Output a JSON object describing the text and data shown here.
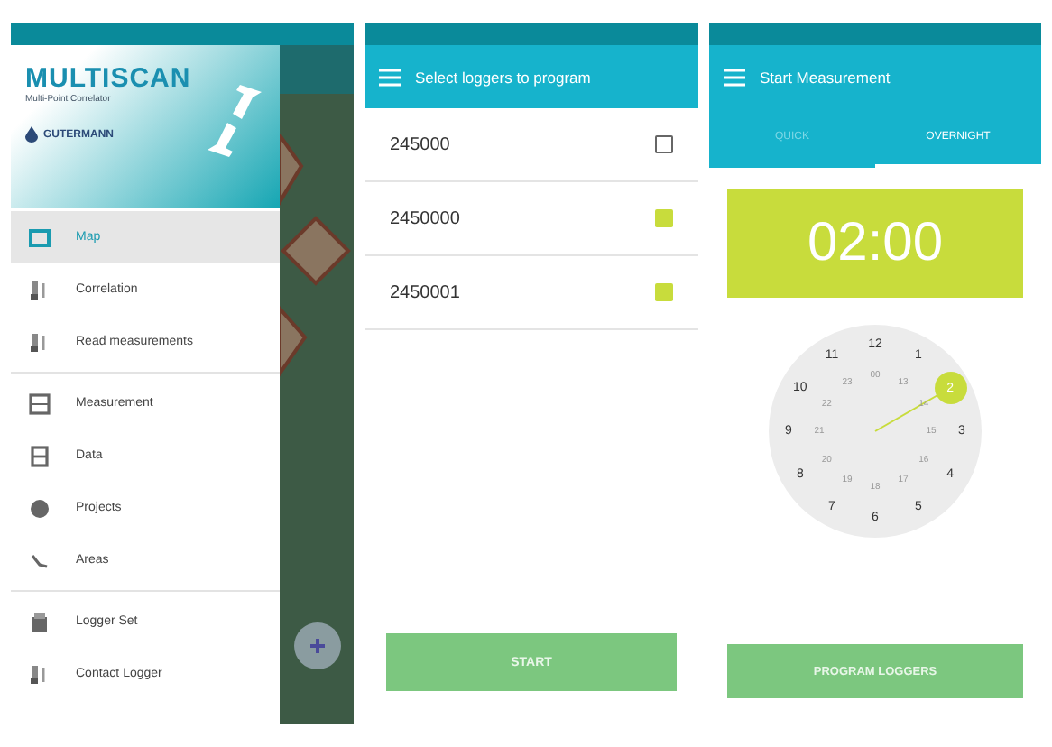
{
  "drawer": {
    "logo": {
      "brand": "MULTISCAN",
      "subtitle": "Multi-Point Correlator",
      "maker": "GUTERMANN"
    },
    "groups": [
      [
        {
          "label": "Map",
          "selected": true
        },
        {
          "label": "Correlation",
          "selected": false
        },
        {
          "label": "Read measurements",
          "selected": false
        }
      ],
      [
        {
          "label": "Measurement",
          "selected": false
        },
        {
          "label": "Data",
          "selected": false
        },
        {
          "label": "Projects",
          "selected": false
        },
        {
          "label": "Areas",
          "selected": false
        }
      ],
      [
        {
          "label": "Logger Set",
          "selected": false
        },
        {
          "label": "Contact Logger",
          "selected": false
        }
      ]
    ]
  },
  "logger_screen": {
    "title": "Select loggers to program",
    "loggers": [
      {
        "id": "245000",
        "checked": false
      },
      {
        "id": "2450000",
        "checked": true
      },
      {
        "id": "2450001",
        "checked": true
      }
    ],
    "button": "START"
  },
  "measure_screen": {
    "title": "Start Measurement",
    "tabs": [
      {
        "label": "QUICK",
        "selected": false
      },
      {
        "label": "OVERNIGHT",
        "selected": true
      }
    ],
    "time": "02:00",
    "clock": {
      "outer": [
        {
          "label": "12",
          "selected": false
        },
        {
          "label": "1",
          "selected": false
        },
        {
          "label": "2",
          "selected": true
        },
        {
          "label": "3",
          "selected": false
        },
        {
          "label": "4",
          "selected": false
        },
        {
          "label": "5",
          "selected": false
        },
        {
          "label": "6",
          "selected": false
        },
        {
          "label": "7",
          "selected": false
        },
        {
          "label": "8",
          "selected": false
        },
        {
          "label": "9",
          "selected": false
        },
        {
          "label": "10",
          "selected": false
        },
        {
          "label": "11",
          "selected": false
        }
      ],
      "inner": [
        "00",
        "13",
        "14",
        "15",
        "16",
        "17",
        "18",
        "19",
        "20",
        "21",
        "22",
        "23"
      ]
    },
    "button": "PROGRAM LOGGERS"
  }
}
